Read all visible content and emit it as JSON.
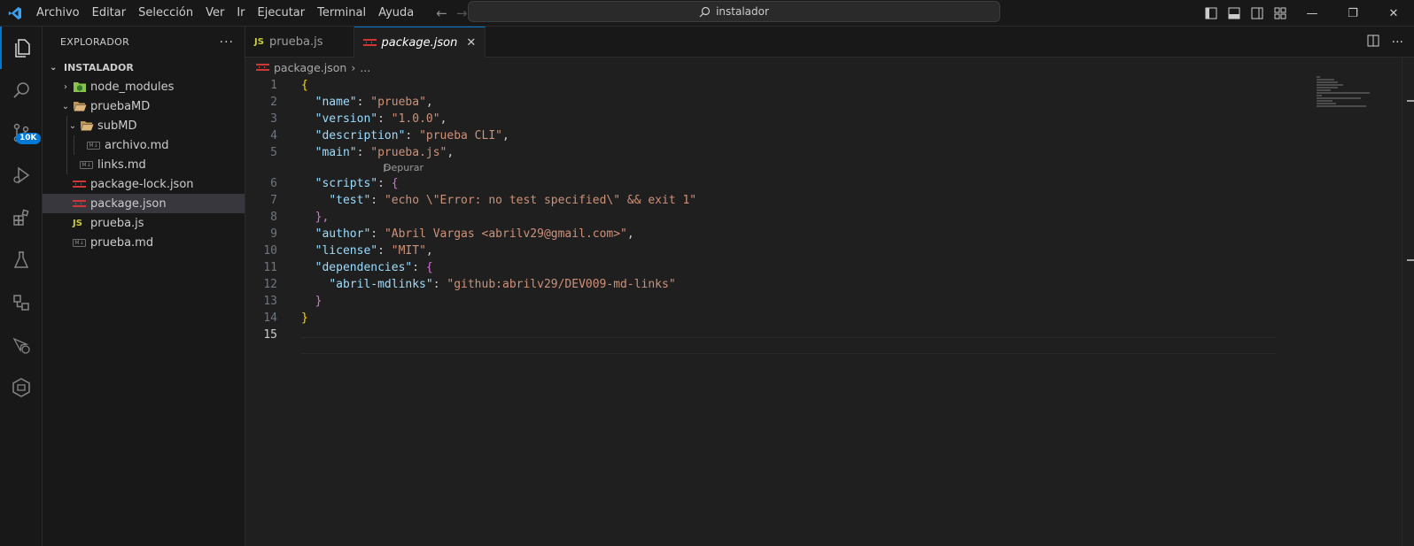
{
  "menu": [
    "Archivo",
    "Editar",
    "Selección",
    "Ver",
    "Ir",
    "Ejecutar",
    "Terminal",
    "Ayuda"
  ],
  "search": {
    "text": "instalador"
  },
  "activity_badge": "10K",
  "sidebar": {
    "title": "EXPLORADOR",
    "root": "INSTALADOR",
    "items": [
      {
        "label": "node_modules",
        "icon": "node-folder-icon"
      },
      {
        "label": "pruebaMD",
        "icon": "folder-open-icon"
      },
      {
        "label": "subMD",
        "icon": "folder-open-icon"
      },
      {
        "label": "archivo.md",
        "icon": "markdown-icon"
      },
      {
        "label": "links.md",
        "icon": "markdown-icon"
      },
      {
        "label": "package-lock.json",
        "icon": "npm-icon"
      },
      {
        "label": "package.json",
        "icon": "npm-icon"
      },
      {
        "label": "prueba.js",
        "icon": "js-icon"
      },
      {
        "label": "prueba.md",
        "icon": "markdown-icon"
      }
    ]
  },
  "tabs": [
    {
      "label": "prueba.js",
      "icon_text": "JS"
    },
    {
      "label": "package.json",
      "active": true
    }
  ],
  "breadcrumb": {
    "file": "package.json",
    "rest": "..."
  },
  "codelens": "Depurar",
  "code": {
    "l1": "{",
    "name_key": "\"name\"",
    "name_val": "\"prueba\"",
    "version_key": "\"version\"",
    "version_val": "\"1.0.0\"",
    "description_key": "\"description\"",
    "description_val": "\"prueba CLI\"",
    "main_key": "\"main\"",
    "main_val": "\"prueba.js\"",
    "scripts_key": "\"scripts\"",
    "test_key": "\"test\"",
    "test_val": "\"echo \\\"Error: no test specified\\\" && exit 1\"",
    "author_key": "\"author\"",
    "author_val": "\"Abril Vargas <abrilv29@gmail.com>\"",
    "license_key": "\"license\"",
    "license_val": "\"MIT\"",
    "dependencies_key": "\"dependencies\"",
    "dep_key": "\"abril-mdlinks\"",
    "dep_val": "\"github:abrilv29/DEV009-md-links\"",
    "open_brace": "{",
    "close_brace": "}",
    "close_brace_comma": "},",
    "colon": ": ",
    "comma": ","
  },
  "line_numbers": [
    "1",
    "2",
    "3",
    "4",
    "5",
    "6",
    "7",
    "8",
    "9",
    "10",
    "11",
    "12",
    "13",
    "14",
    "15"
  ],
  "colors": {
    "accent": "#0078d4",
    "string": "#ce9178",
    "key": "#9cdcfe",
    "bracket1": "#ffd700",
    "bracket2": "#da70d6"
  }
}
